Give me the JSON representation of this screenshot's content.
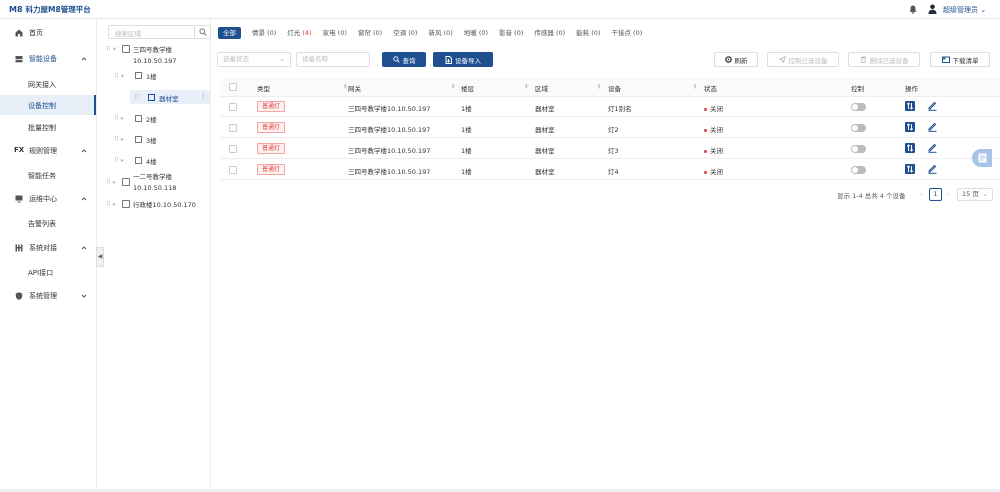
{
  "app": {
    "logo_mark": "M8",
    "title": "科力屋M8管理平台",
    "user": "超级管理员",
    "colors": {
      "primary": "#1f4f8f",
      "danger": "#e04040"
    }
  },
  "sidebar": {
    "items": [
      {
        "label": "首页",
        "icon": "home-icon"
      },
      {
        "label": "智能设备",
        "icon": "device-icon",
        "expanded": true,
        "children": [
          "网关接入",
          "设备控制",
          "批量控制"
        ]
      },
      {
        "label": "规则管理",
        "icon": "fx-icon",
        "expanded": true,
        "children": [
          "智能任务"
        ]
      },
      {
        "label": "运维中心",
        "icon": "monitor-icon",
        "expanded": true,
        "children": [
          "告警列表"
        ]
      },
      {
        "label": "系统对接",
        "icon": "connect-icon",
        "expanded": true,
        "children": [
          "API接口"
        ]
      },
      {
        "label": "系统管理",
        "icon": "shield-icon",
        "expanded": false
      }
    ],
    "fx_glyph": "FX",
    "active": "设备控制"
  },
  "tree": {
    "search_placeholder": "搜索区域",
    "nodes": {
      "b1_name": "三四号教学楼",
      "b1_ip": "10.10.50.197",
      "f1": "1楼",
      "room": "器材室",
      "f2": "2楼",
      "f3": "3楼",
      "f4": "4楼",
      "b2_name": "一二号教学楼",
      "b2_ip": "10.10.50.118",
      "b3": "行政楼10.10.50.170"
    }
  },
  "tabs": [
    {
      "label": "全部",
      "active": true
    },
    {
      "label": "情景",
      "count": "(0)"
    },
    {
      "label": "灯光",
      "count": "(4)",
      "count_red": true
    },
    {
      "label": "家电",
      "count": "(0)"
    },
    {
      "label": "窗帘",
      "count": "(0)"
    },
    {
      "label": "空调",
      "count": "(0)"
    },
    {
      "label": "新风",
      "count": "(0)"
    },
    {
      "label": "地暖",
      "count": "(0)"
    },
    {
      "label": "影音",
      "count": "(0)"
    },
    {
      "label": "传感器",
      "count": "(0)"
    },
    {
      "label": "能耗",
      "count": "(0)"
    },
    {
      "label": "干接点",
      "count": "(0)"
    }
  ],
  "filters": {
    "status_placeholder": "设备状态",
    "name_placeholder": "设备名称",
    "search": "查询",
    "import": "设备导入"
  },
  "actions": {
    "refresh": "刷新",
    "control_selected": "控制已选设备",
    "delete_selected": "删除已选设备",
    "download": "下载清单"
  },
  "table": {
    "headers": {
      "type": "类型",
      "gateway": "网关",
      "floor": "楼层",
      "area": "区域",
      "device": "设备",
      "status": "状态",
      "control": "控制",
      "ops": "操作"
    },
    "rows": [
      {
        "type": "普通灯",
        "gateway": "三四号教学楼10.10.50.197",
        "floor": "1楼",
        "area": "器材室",
        "device": "灯1别名",
        "status": "关闭"
      },
      {
        "type": "普通灯",
        "gateway": "三四号教学楼10.10.50.197",
        "floor": "1楼",
        "area": "器材室",
        "device": "灯2",
        "status": "关闭"
      },
      {
        "type": "普通灯",
        "gateway": "三四号教学楼10.10.50.197",
        "floor": "1楼",
        "area": "器材室",
        "device": "灯3",
        "status": "关闭"
      },
      {
        "type": "普通灯",
        "gateway": "三四号教学楼10.10.50.197",
        "floor": "1楼",
        "area": "器材室",
        "device": "灯4",
        "status": "关闭"
      }
    ]
  },
  "pagination": {
    "summary": "显示 1-4 总共 4 个设备",
    "current": "1",
    "page_size": "15 页"
  }
}
